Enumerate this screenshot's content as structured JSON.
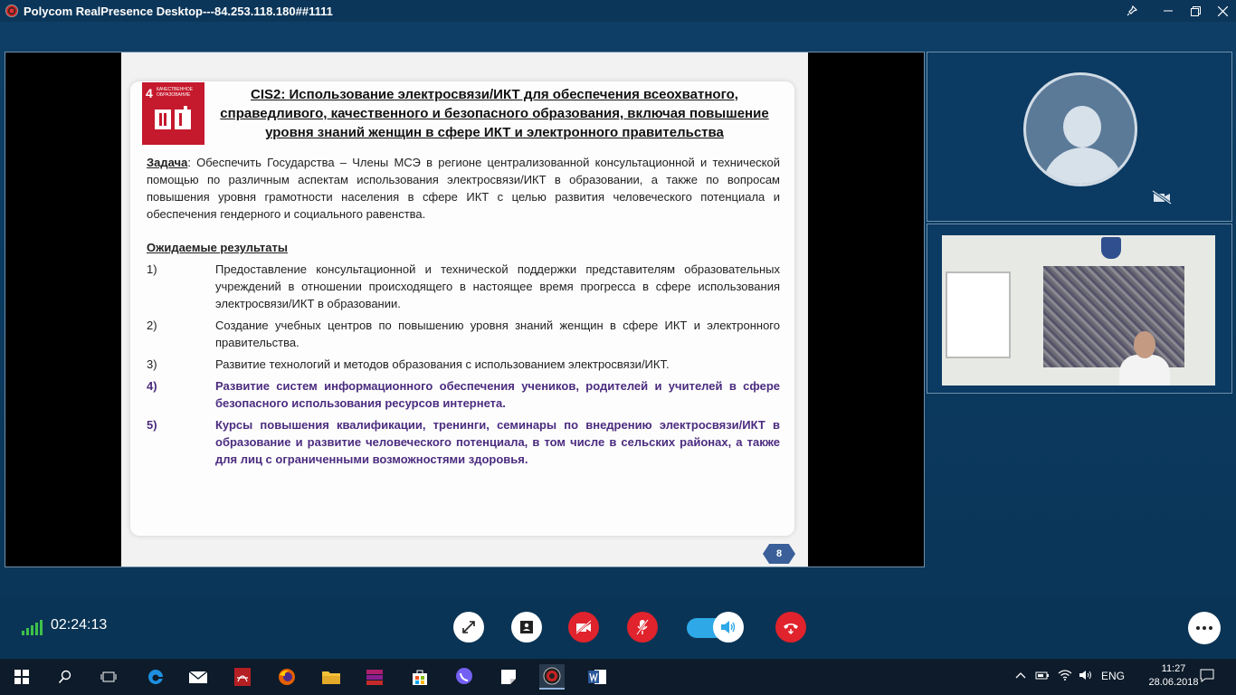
{
  "window": {
    "title": "Polycom RealPresence Desktop---84.253.118.180##1111"
  },
  "slide": {
    "sdg_number": "4",
    "sdg_label": "КАЧЕСТВЕННОЕ ОБРАЗОВАНИЕ",
    "title": "CIS2: Использование электросвязи/ИКТ для обеспечения всеохватного, справедливого, качественного и безопасного образования, включая повышение уровня знаний женщин в сфере ИКТ и электронного правительства",
    "task_label": "Задача",
    "task_text": ": Обеспечить Государства – Члены МСЭ в регионе централизованной консультационной и технической помощью по различным аспектам использования электросвязи/ИКТ в образовании, а также по вопросам повышения уровня грамотности населения в сфере ИКТ с целью развития человеческого потенциала и обеспечения гендерного и социального равенства.",
    "results_heading": "Ожидаемые результаты",
    "items": [
      {
        "num": "1)",
        "text": "Предоставление консультационной и технической поддержки представителям образовательных учреждений в отношении происходящего в настоящее время прогресса в сфере использования электросвязи/ИКТ в образовании."
      },
      {
        "num": "2)",
        "text": "Создание учебных центров по повышению уровня знаний женщин в сфере ИКТ и электронного правительства."
      },
      {
        "num": "3)",
        "text": "Развитие технологий и методов образования с использованием электросвязи/ИКТ."
      },
      {
        "num": "4)",
        "text": "Развитие систем информационного обеспечения учеников, родителей и учителей в сфере безопасного использования ресурсов интернета."
      },
      {
        "num": "5)",
        "text": "Курсы повышения квалификации, тренинги, семинары по внедрению электросвязи/ИКТ в образование и развитие человеческого потенциала, в том числе в сельских районах, а также для лиц с ограниченными возможностями здоровья."
      }
    ],
    "page_number": "8"
  },
  "call": {
    "duration": "02:24:13"
  },
  "taskbar": {
    "language": "ENG",
    "time": "11:27",
    "date": "28.06.2018"
  },
  "colors": {
    "background": "#0b3a60",
    "end_call": "#e0232c",
    "volume_toggle": "#2ea8e7",
    "sdg_red": "#c5192d",
    "purple_text": "#4b2c7f"
  }
}
